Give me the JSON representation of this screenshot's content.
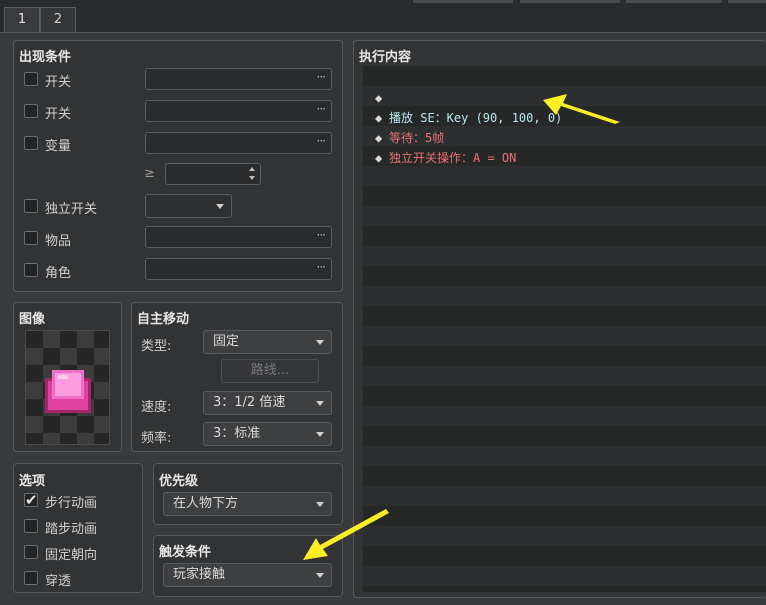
{
  "tabs": [
    {
      "label": "1",
      "active": true
    },
    {
      "label": "2",
      "active": false
    }
  ],
  "conditions": {
    "title": "出现条件",
    "switch1": {
      "label": "开关",
      "checked": false,
      "value": ""
    },
    "switch2": {
      "label": "开关",
      "checked": false,
      "value": ""
    },
    "variable": {
      "label": "变量",
      "checked": false,
      "value": "",
      "ge_symbol": "≥",
      "ge_value": ""
    },
    "self_switch": {
      "label": "独立开关",
      "checked": false,
      "value": ""
    },
    "item": {
      "label": "物品",
      "checked": false,
      "value": ""
    },
    "actor": {
      "label": "角色",
      "checked": false,
      "value": ""
    },
    "browse_glyph": "···"
  },
  "image": {
    "title": "图像"
  },
  "autonomous_movement": {
    "title": "自主移动",
    "type_label": "类型:",
    "type_value": "固定",
    "route_button": "路线...",
    "speed_label": "速度:",
    "speed_value": "3：1/2 倍速",
    "freq_label": "频率:",
    "freq_value": "3：标准"
  },
  "options": {
    "title": "选项",
    "items": [
      {
        "label": "步行动画",
        "checked": true
      },
      {
        "label": "踏步动画",
        "checked": false
      },
      {
        "label": "固定朝向",
        "checked": false
      },
      {
        "label": "穿透",
        "checked": false
      }
    ]
  },
  "priority": {
    "title": "优先级",
    "value": "在人物下方"
  },
  "trigger": {
    "title": "触发条件",
    "value": "玩家接触"
  },
  "contents": {
    "title": "执行内容",
    "lines": [
      {
        "marker": "◆",
        "text": "播放 SE：Key (90, 100, 0)",
        "color": "#b8e6f0"
      },
      {
        "marker": "◆",
        "text": "等待：5帧",
        "color": "#e87070"
      },
      {
        "marker": "◆",
        "text": "独立开关操作：A = ON",
        "color": "#e87070"
      },
      {
        "marker": "◆",
        "text": "",
        "color": "#dcdcdc"
      }
    ]
  },
  "annotation_color": "#ffee22"
}
